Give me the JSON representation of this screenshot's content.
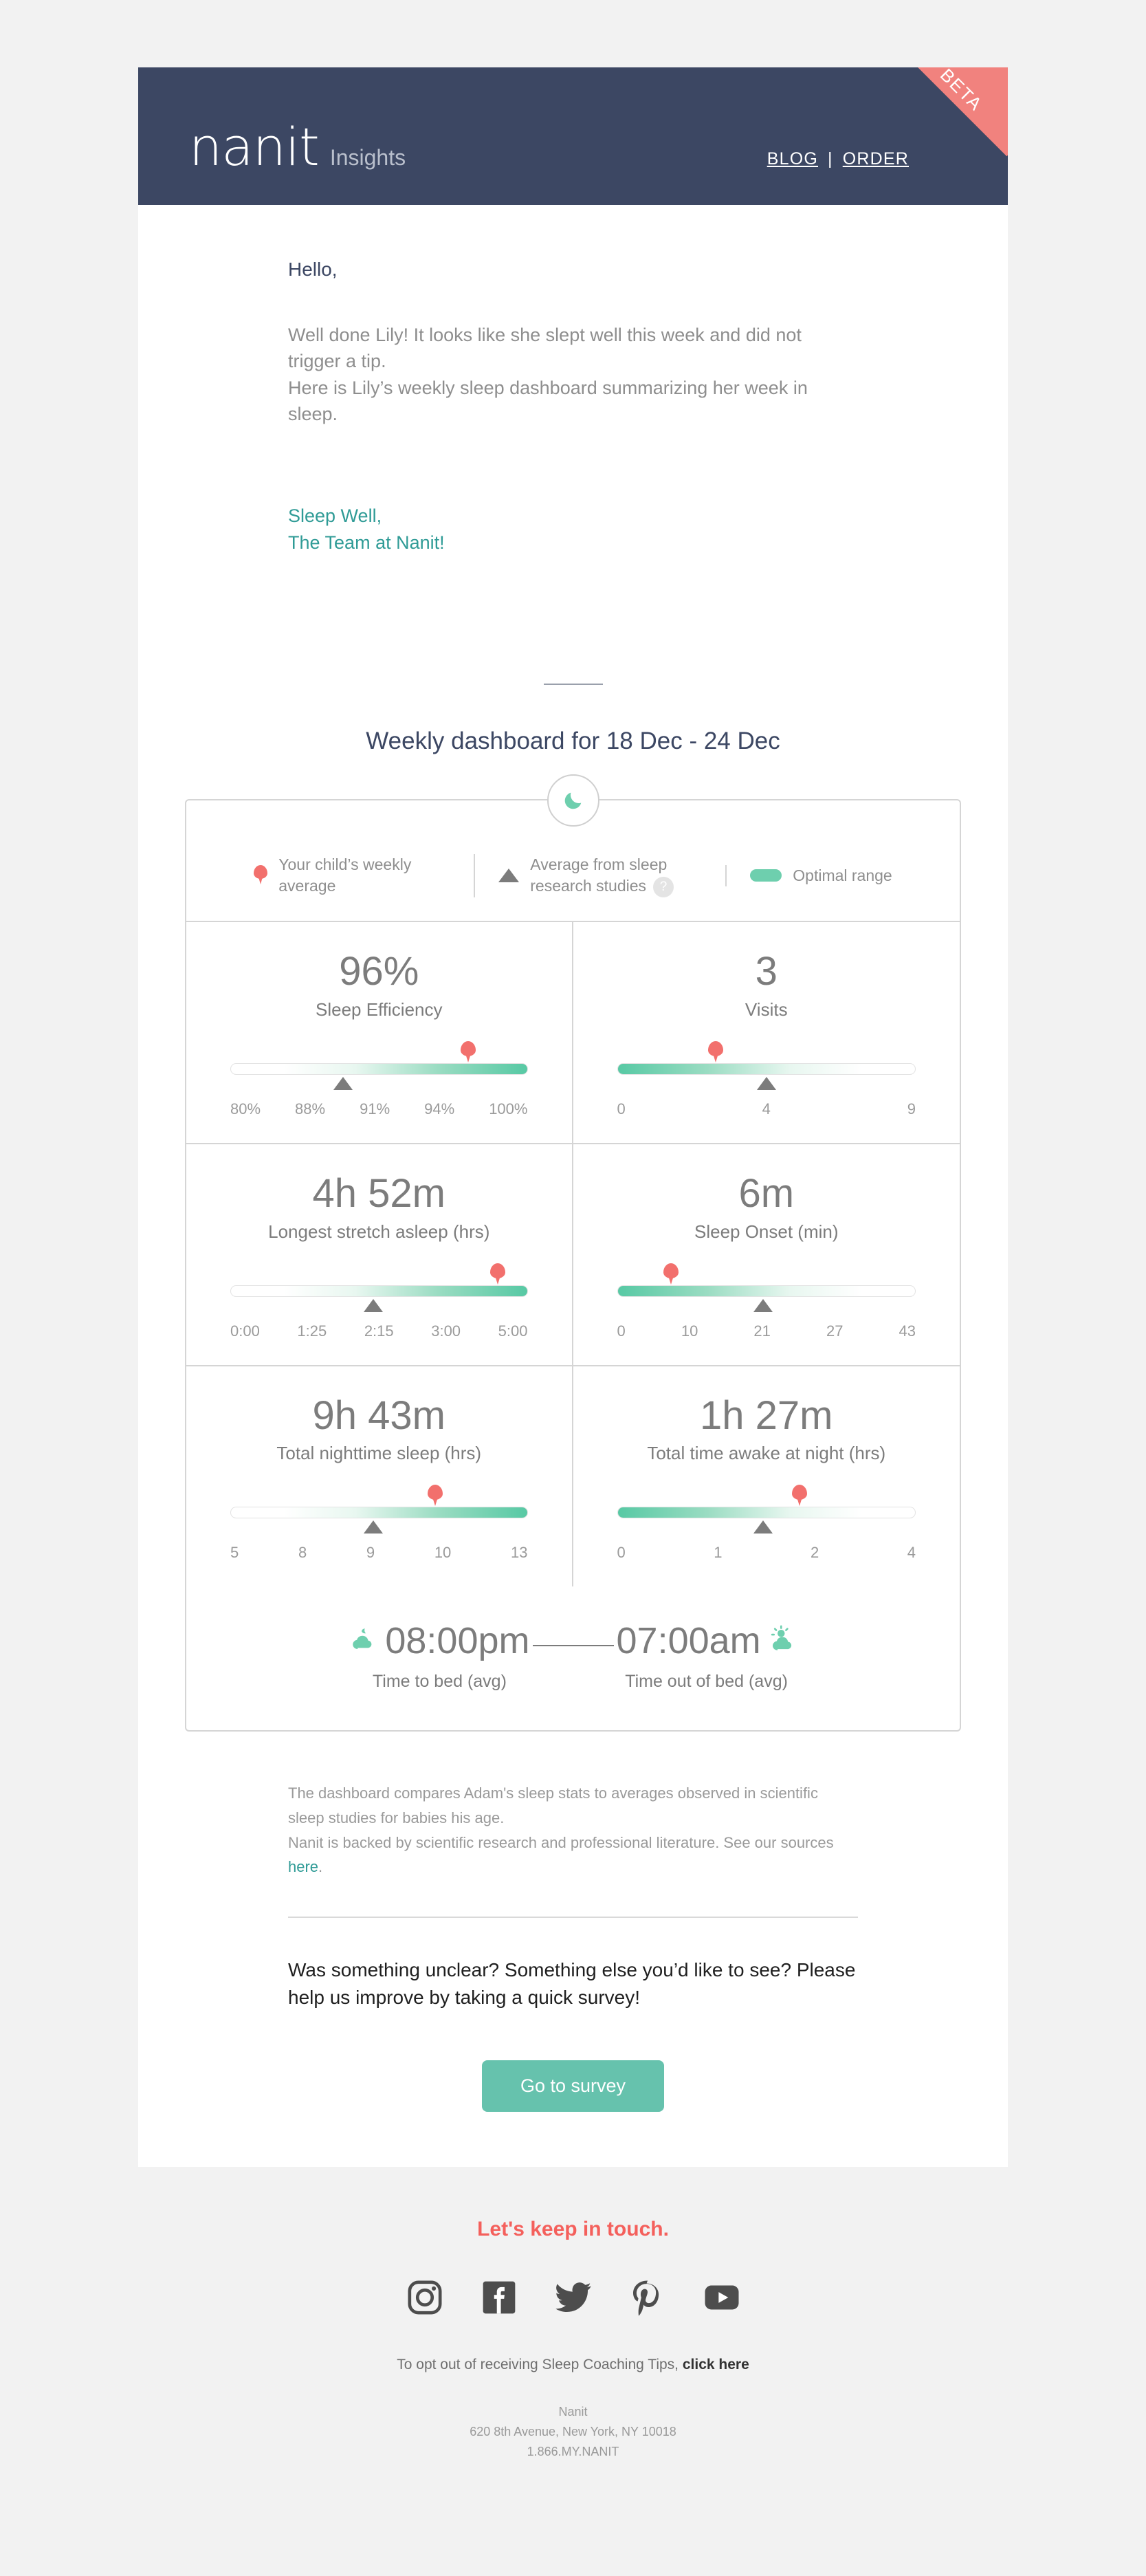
{
  "header": {
    "logo": "nanit",
    "logo_sub": "Insights",
    "blog": "BLOG",
    "separator": "|",
    "order": "ORDER",
    "beta": "BETA",
    "bg_color": "#3c4763",
    "ribbon_color": "#f1827e"
  },
  "intro": {
    "greeting": "Hello,",
    "paragraph_line1": "Well done Lily! It looks like she slept well this week and did not trigger a tip.",
    "paragraph_line2": "Here is Lily’s weekly sleep dashboard summarizing her week in sleep.",
    "sign_line1": "Sleep Well,",
    "sign_line2": "The Team at Nanit!",
    "sign_color": "#2f9b96"
  },
  "dashboard": {
    "title": "Weekly dashboard for 18 Dec - 24 Dec",
    "moon_icon": "moon-icon",
    "legend": [
      {
        "icon": "pin-icon",
        "label": "Your child’s weekly average"
      },
      {
        "icon": "triangle-icon",
        "label": "Average from sleep research studies",
        "help": "?"
      },
      {
        "icon": "range-chip-icon",
        "label": "Optimal range"
      }
    ],
    "accent_green": "#57c9a4",
    "accent_red": "#f2706d"
  },
  "chart_data": {
    "type": "bar",
    "title": "Weekly dashboard for 18 Dec - 24 Dec",
    "metrics": [
      {
        "value": "96%",
        "label": "Sleep Efficiency",
        "ticks": [
          "80%",
          "88%",
          "91%",
          "94%",
          "100%"
        ],
        "child_pct": 80,
        "avg_pct": 38,
        "gradient": "asc"
      },
      {
        "value": "3",
        "label": "Visits",
        "ticks": [
          "0",
          "4",
          "9"
        ],
        "child_pct": 33,
        "avg_pct": 50,
        "gradient": "desc"
      },
      {
        "value": "4h 52m",
        "label": "Longest stretch asleep (hrs)",
        "ticks": [
          "0:00",
          "1:25",
          "2:15",
          "3:00",
          "5:00"
        ],
        "child_pct": 90,
        "avg_pct": 48,
        "gradient": "asc"
      },
      {
        "value": "6m",
        "label": "Sleep Onset (min)",
        "ticks": [
          "0",
          "10",
          "21",
          "27",
          "43"
        ],
        "child_pct": 18,
        "avg_pct": 49,
        "gradient": "desc"
      },
      {
        "value": "9h 43m",
        "label": "Total nighttime sleep (hrs)",
        "ticks": [
          "5",
          "8",
          "9",
          "10",
          "13"
        ],
        "child_pct": 69,
        "avg_pct": 48,
        "gradient": "asc"
      },
      {
        "value": "1h 27m",
        "label": "Total time awake at night (hrs)",
        "ticks": [
          "0",
          "1",
          "2",
          "4"
        ],
        "child_pct": 61,
        "avg_pct": 49,
        "gradient": "desc"
      }
    ],
    "bedtime": {
      "bed_time": "08:00pm",
      "bed_label": "Time to bed (avg)",
      "bed_icon": "moon-cloud-icon",
      "wake_time": "07:00am",
      "wake_label": "Time out of bed (avg)",
      "wake_icon": "sun-cloud-icon"
    }
  },
  "notes": {
    "line1": "The dashboard compares Adam's sleep stats to averages observed in scientific sleep studies for babies his age.",
    "line2_pre": "Nanit is backed by scientific research and professional literature. See our sources ",
    "line2_link": "here",
    "line2_post": "."
  },
  "survey": {
    "text": "Was something unclear? Something else you’d like to see? Please help us improve by taking a quick survey!",
    "button": "Go to survey",
    "button_color": "#66c2ad"
  },
  "footer": {
    "keep_in_touch": "Let's keep in touch.",
    "keep_color": "#f4605c",
    "socials": [
      {
        "name": "instagram-icon"
      },
      {
        "name": "facebook-icon"
      },
      {
        "name": "twitter-icon"
      },
      {
        "name": "pinterest-icon"
      },
      {
        "name": "youtube-icon"
      }
    ],
    "optout_pre": "To opt out of receiving Sleep Coaching Tips, ",
    "optout_link": "click here",
    "address_line1": "Nanit",
    "address_line2": "620 8th Avenue, New York, NY 10018",
    "address_line3": "1.866.MY.NANIT"
  }
}
